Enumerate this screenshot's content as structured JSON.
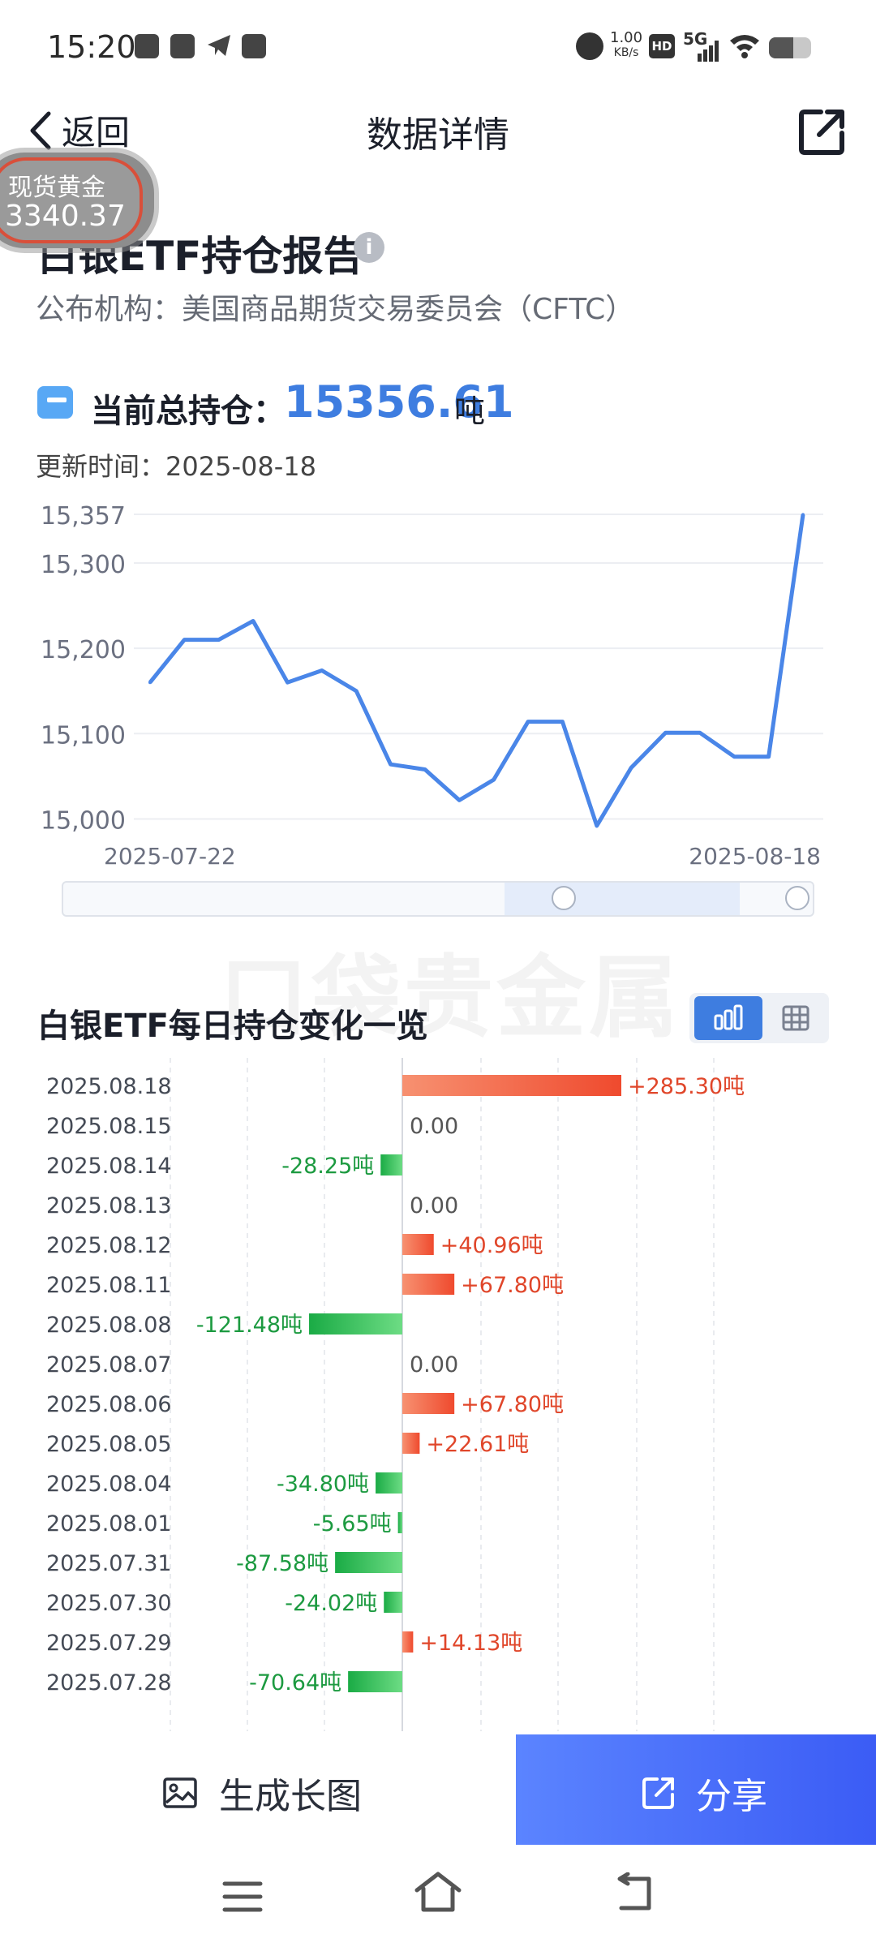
{
  "status": {
    "time": "15:20",
    "net_speed": "1.00",
    "net_unit": "KB/s",
    "hd": "HD",
    "signal": "5G"
  },
  "nav": {
    "back_label": "返回",
    "title": "数据详情"
  },
  "gold": {
    "name": "现货黄金",
    "value": "3340.37"
  },
  "header": {
    "title": "白银ETF持仓报告",
    "publisher": "公布机构：美国商品期货交易委员会（CFTC）",
    "holding_label": "当前总持仓：",
    "holding_value": "15356.61",
    "holding_unit": "吨",
    "update_time": "更新时间：2025-08-18"
  },
  "watermark": "口袋贵金属",
  "daily": {
    "title": "白银ETF每日持仓变化一览"
  },
  "actions": {
    "generate_label": "生成长图",
    "share_label": "分享"
  },
  "colors": {
    "accent": "#3e7de0",
    "up": "#f05a3a",
    "down": "#21b04b"
  },
  "chart_data": [
    {
      "type": "line",
      "ylabel_ticks": [
        "15,357",
        "15,300",
        "15,200",
        "15,100",
        "15,000"
      ],
      "ytick_values": [
        15357,
        15300,
        15200,
        15100,
        15000
      ],
      "x_labels": [
        "2025-07-22",
        "2025-08-18"
      ],
      "ylim": [
        14990,
        15357
      ],
      "grid": true,
      "values": [
        15160,
        15210,
        15210,
        15232,
        15160,
        15174,
        15150,
        15064,
        15058,
        15022,
        15046,
        15114,
        15114,
        14992,
        15060,
        15101,
        15101,
        15073,
        15073,
        15356.61
      ]
    },
    {
      "type": "bar",
      "orientation": "horizontal",
      "categories": [
        "2025.08.18",
        "2025.08.15",
        "2025.08.14",
        "2025.08.13",
        "2025.08.12",
        "2025.08.11",
        "2025.08.08",
        "2025.08.07",
        "2025.08.06",
        "2025.08.05",
        "2025.08.04",
        "2025.08.01",
        "2025.07.31",
        "2025.07.30",
        "2025.07.29",
        "2025.07.28"
      ],
      "values": [
        285.3,
        0,
        -28.25,
        0,
        40.96,
        67.8,
        -121.48,
        0,
        67.8,
        22.61,
        -34.8,
        -5.65,
        -87.58,
        -24.02,
        14.13,
        -70.64
      ],
      "labels": [
        "+285.30吨",
        "0.00",
        "-28.25吨",
        "0.00",
        "+40.96吨",
        "+67.80吨",
        "-121.48吨",
        "0.00",
        "+67.80吨",
        "+22.61吨",
        "-34.80吨",
        "-5.65吨",
        "-87.58吨",
        "-24.02吨",
        "+14.13吨",
        "-70.64吨"
      ]
    }
  ]
}
